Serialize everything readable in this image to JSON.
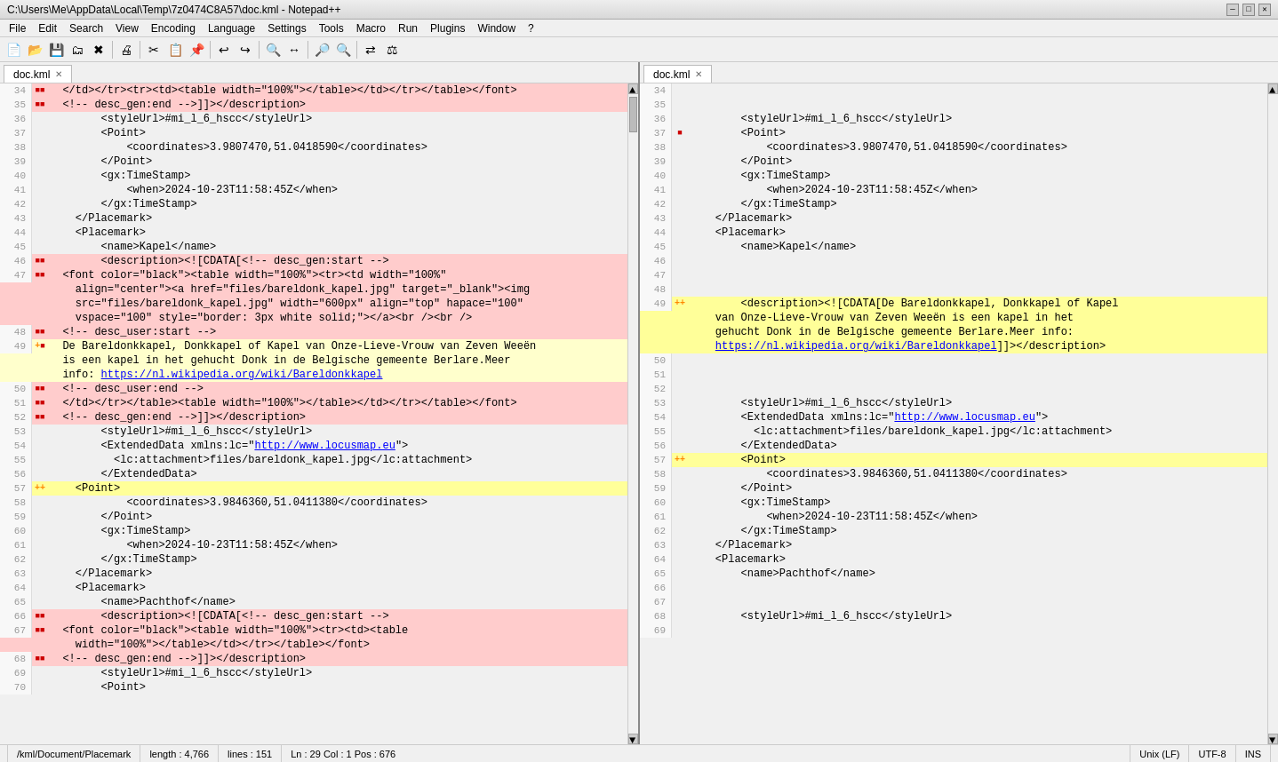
{
  "window": {
    "title": "C:\\Users\\Me\\AppData\\Local\\Temp\\7z0474C8A57\\doc.kml - Notepad++",
    "controls": [
      "—",
      "□",
      "✕"
    ]
  },
  "menu": {
    "items": [
      "File",
      "Edit",
      "Search",
      "View",
      "Encoding",
      "Language",
      "Settings",
      "Tools",
      "Macro",
      "Run",
      "Plugins",
      "Window",
      "?"
    ]
  },
  "tabs": [
    {
      "label": "doc.kml",
      "active": true
    },
    {
      "label": "doc.kml",
      "active": true
    }
  ],
  "status": {
    "path": "/kml/Document/Placemark",
    "length": "length : 4,766",
    "lines": "lines : 151",
    "position": "Ln : 29   Col : 1   Pos : 676",
    "encoding": "Unix (LF)",
    "format": "UTF-8",
    "mode": "INS"
  },
  "left_pane": {
    "lines": [
      {
        "num": 34,
        "bg": "bg-red",
        "marker": "▪▪",
        "content": "  </td></tr><tr><td><table width=\"100%\"></table></td></tr></table></font>"
      },
      {
        "num": 35,
        "bg": "bg-red",
        "marker": "▪▪",
        "content": "  <!-- desc_gen:end -->]]></description>"
      },
      {
        "num": 36,
        "bg": "",
        "marker": "",
        "content": "        <styleUrl>#mi_l_6_hscc</styleUrl>"
      },
      {
        "num": 37,
        "bg": "",
        "marker": "",
        "content": "        <Point>"
      },
      {
        "num": 38,
        "bg": "",
        "marker": "",
        "content": "            <coordinates>3.9807470,51.0418590</coordinates>"
      },
      {
        "num": 39,
        "bg": "",
        "marker": "",
        "content": "        </Point>"
      },
      {
        "num": 40,
        "bg": "",
        "marker": "",
        "content": "        <gx:TimeStamp>"
      },
      {
        "num": 41,
        "bg": "",
        "marker": "",
        "content": "            <when>2024-10-23T11:58:45Z</when>"
      },
      {
        "num": 42,
        "bg": "",
        "marker": "",
        "content": "        </gx:TimeStamp>"
      },
      {
        "num": 43,
        "bg": "",
        "marker": "",
        "content": "    </Placemark>"
      },
      {
        "num": 44,
        "bg": "",
        "marker": "",
        "content": "    <Placemark>"
      },
      {
        "num": 45,
        "bg": "",
        "marker": "",
        "content": "        <name>Kapel</name>"
      },
      {
        "num": 46,
        "bg": "bg-red",
        "marker": "▪▪",
        "content": "        <description><![CDATA[<!-- desc_gen:start -->"
      },
      {
        "num": 47,
        "bg": "bg-red",
        "marker": "▪▪",
        "content": "  <font color=\"black\"><table width=\"100%\"><tr><td width=\"100%\""
      },
      {
        "num": 47,
        "bg": "bg-red",
        "marker": "",
        "content": "    align=\"center\"><a href=\"files/bareldonk_kapel.jpg\" target=\"_blank\"><img"
      },
      {
        "num": 47,
        "bg": "bg-red",
        "marker": "",
        "content": "    src=\"files/bareldonk_kapel.jpg\" width=\"600px\" align=\"top\" hapace=\"100\""
      },
      {
        "num": 47,
        "bg": "bg-red",
        "marker": "",
        "content": "    vspace=\"100\" style=\"border: 3px white solid;\"></a><br /><br />"
      },
      {
        "num": 48,
        "bg": "bg-red",
        "marker": "▪▪",
        "content": "  <!-- desc_user:start -->"
      },
      {
        "num": 49,
        "bg": "bg-yellow",
        "marker": "+▪",
        "content": "  De Bareldonkkapel, Donkkapel of Kapel van Onze-Lieve-Vrouw van Zeven Weeën"
      },
      {
        "num": 49,
        "bg": "bg-yellow",
        "marker": "",
        "content": "  is een kapel in het gehucht Donk in de Belgische gemeente Berlare.Meer"
      },
      {
        "num": 49,
        "bg": "bg-yellow",
        "marker": "",
        "content": "  info: https://nl.wikipedia.org/wiki/Bareldonkkapel"
      },
      {
        "num": 50,
        "bg": "bg-red",
        "marker": "▪▪",
        "content": "  <!-- desc_user:end -->"
      },
      {
        "num": 51,
        "bg": "bg-red",
        "marker": "▪▪",
        "content": "  </td></tr></table><table width=\"100%\"></table></td></tr></table></font>"
      },
      {
        "num": 52,
        "bg": "bg-red",
        "marker": "▪▪",
        "content": "  <!-- desc_gen:end -->]]></description>"
      },
      {
        "num": 53,
        "bg": "",
        "marker": "",
        "content": "        <styleUrl>#mi_l_6_hscc</styleUrl>"
      },
      {
        "num": 54,
        "bg": "",
        "marker": "",
        "content": "        <ExtendedData xmlns:lc=\"http://www.locusmap.eu\">"
      },
      {
        "num": 55,
        "bg": "",
        "marker": "",
        "content": "          <lc:attachment>files/bareldonk_kapel.jpg</lc:attachment>"
      },
      {
        "num": 56,
        "bg": "",
        "marker": "",
        "content": "        </ExtendedData>"
      },
      {
        "num": 57,
        "bg": "bg-yellow2",
        "marker": "++",
        "content": "    <Point>"
      },
      {
        "num": 58,
        "bg": "",
        "marker": "",
        "content": "            <coordinates>3.9846360,51.0411380</coordinates>"
      },
      {
        "num": 59,
        "bg": "",
        "marker": "",
        "content": "        </Point>"
      },
      {
        "num": 60,
        "bg": "",
        "marker": "",
        "content": "        <gx:TimeStamp>"
      },
      {
        "num": 61,
        "bg": "",
        "marker": "",
        "content": "            <when>2024-10-23T11:58:45Z</when>"
      },
      {
        "num": 62,
        "bg": "",
        "marker": "",
        "content": "        </gx:TimeStamp>"
      },
      {
        "num": 63,
        "bg": "",
        "marker": "",
        "content": "    </Placemark>"
      },
      {
        "num": 64,
        "bg": "",
        "marker": "",
        "content": "    <Placemark>"
      },
      {
        "num": 65,
        "bg": "",
        "marker": "",
        "content": "        <name>Pachthof</name>"
      },
      {
        "num": 66,
        "bg": "bg-red",
        "marker": "▪▪",
        "content": "        <description><![CDATA[<!-- desc_gen:start -->"
      },
      {
        "num": 67,
        "bg": "bg-red",
        "marker": "▪▪",
        "content": "  <font color=\"black\"><table width=\"100%\"><tr><td><table"
      },
      {
        "num": 67,
        "bg": "bg-red",
        "marker": "",
        "content": "    width=\"100%\"></table></td></tr></table></font>"
      },
      {
        "num": 68,
        "bg": "bg-red",
        "marker": "▪▪",
        "content": "  <!-- desc_gen:end -->]]></description>"
      },
      {
        "num": 69,
        "bg": "",
        "marker": "",
        "content": "        <styleUrl>#mi_l_6_hscc</styleUrl>"
      },
      {
        "num": 70,
        "bg": "",
        "marker": "",
        "content": "        <Point>"
      }
    ]
  },
  "right_pane": {
    "lines": [
      {
        "num": 34,
        "bg": "",
        "marker": "",
        "content": ""
      },
      {
        "num": 35,
        "bg": "",
        "marker": "",
        "content": ""
      },
      {
        "num": 36,
        "bg": "",
        "marker": "",
        "content": "        <styleUrl>#mi_l_6_hscc</styleUrl>"
      },
      {
        "num": 37,
        "bg": "",
        "marker": "▪",
        "content": "        <Point>"
      },
      {
        "num": 38,
        "bg": "",
        "marker": "",
        "content": "            <coordinates>3.9807470,51.0418590</coordinates>"
      },
      {
        "num": 39,
        "bg": "",
        "marker": "",
        "content": "        </Point>"
      },
      {
        "num": 40,
        "bg": "",
        "marker": "",
        "content": "        <gx:TimeStamp>"
      },
      {
        "num": 41,
        "bg": "",
        "marker": "",
        "content": "            <when>2024-10-23T11:58:45Z</when>"
      },
      {
        "num": 42,
        "bg": "",
        "marker": "",
        "content": "        </gx:TimeStamp>"
      },
      {
        "num": 43,
        "bg": "",
        "marker": "",
        "content": "    </Placemark>"
      },
      {
        "num": 44,
        "bg": "",
        "marker": "",
        "content": "    <Placemark>"
      },
      {
        "num": 45,
        "bg": "",
        "marker": "",
        "content": "        <name>Kapel</name>"
      },
      {
        "num": 46,
        "bg": "",
        "marker": "",
        "content": ""
      },
      {
        "num": 47,
        "bg": "",
        "marker": "",
        "content": ""
      },
      {
        "num": 48,
        "bg": "",
        "marker": "",
        "content": ""
      },
      {
        "num": 49,
        "bg": "bg-yellow2",
        "marker": "++",
        "content": "        <description><![CDATA[De Bareldonkkapel, Donkkapel of Kapel"
      },
      {
        "num": 49,
        "bg": "bg-yellow2",
        "marker": "",
        "content": "    van Onze-Lieve-Vrouw van Zeven Weeën is een kapel in het"
      },
      {
        "num": 49,
        "bg": "bg-yellow2",
        "marker": "",
        "content": "    gehucht Donk in de Belgische gemeente Berlare.Meer info:"
      },
      {
        "num": 49,
        "bg": "bg-yellow2",
        "marker": "",
        "content": "    https://nl.wikipedia.org/wiki/Bareldonkkapel]]></description>"
      },
      {
        "num": 50,
        "bg": "",
        "marker": "",
        "content": ""
      },
      {
        "num": 51,
        "bg": "",
        "marker": "",
        "content": ""
      },
      {
        "num": 52,
        "bg": "",
        "marker": "",
        "content": ""
      },
      {
        "num": 53,
        "bg": "",
        "marker": "",
        "content": "        <styleUrl>#mi_l_6_hscc</styleUrl>"
      },
      {
        "num": 54,
        "bg": "",
        "marker": "",
        "content": "        <ExtendedData xmlns:lc=\"http://www.locusmap.eu\">"
      },
      {
        "num": 55,
        "bg": "",
        "marker": "",
        "content": "          <lc:attachment>files/bareldonk_kapel.jpg</lc:attachment>"
      },
      {
        "num": 56,
        "bg": "",
        "marker": "",
        "content": "        </ExtendedData>"
      },
      {
        "num": 57,
        "bg": "bg-yellow2",
        "marker": "++",
        "content": "        <Point>"
      },
      {
        "num": 58,
        "bg": "",
        "marker": "",
        "content": "            <coordinates>3.9846360,51.0411380</coordinates>"
      },
      {
        "num": 59,
        "bg": "",
        "marker": "",
        "content": "        </Point>"
      },
      {
        "num": 60,
        "bg": "",
        "marker": "",
        "content": "        <gx:TimeStamp>"
      },
      {
        "num": 61,
        "bg": "",
        "marker": "",
        "content": "            <when>2024-10-23T11:58:45Z</when>"
      },
      {
        "num": 62,
        "bg": "",
        "marker": "",
        "content": "        </gx:TimeStamp>"
      },
      {
        "num": 63,
        "bg": "",
        "marker": "",
        "content": "    </Placemark>"
      },
      {
        "num": 64,
        "bg": "",
        "marker": "",
        "content": "    <Placemark>"
      },
      {
        "num": 65,
        "bg": "",
        "marker": "",
        "content": "        <name>Pachthof</name>"
      },
      {
        "num": 66,
        "bg": "",
        "marker": "",
        "content": ""
      },
      {
        "num": 67,
        "bg": "",
        "marker": "",
        "content": ""
      },
      {
        "num": 68,
        "bg": "",
        "marker": "",
        "content": "        <styleUrl>#mi_l_6_hscc</styleUrl>"
      },
      {
        "num": 69,
        "bg": "",
        "marker": "",
        "content": ""
      }
    ]
  }
}
